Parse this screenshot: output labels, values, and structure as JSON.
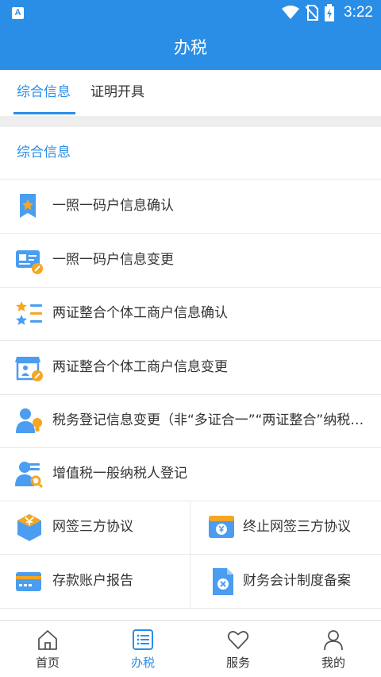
{
  "status_bar": {
    "time": "3:22",
    "app_badge": "A"
  },
  "header": {
    "title": "办税"
  },
  "tabs": [
    {
      "label": "综合信息",
      "active": true
    },
    {
      "label": "证明开具",
      "active": false
    }
  ],
  "section": {
    "title": "综合信息"
  },
  "list_items": [
    {
      "label": "一照一码户信息确认",
      "icon": "star-ribbon-icon"
    },
    {
      "label": "一照一码户信息变更",
      "icon": "id-card-edit-icon"
    },
    {
      "label": "两证整合个体工商户信息确认",
      "icon": "star-list-icon"
    },
    {
      "label": "两证整合个体工商户信息变更",
      "icon": "shop-edit-icon"
    },
    {
      "label": "税务登记信息变更（非“多证合一”“两证整合”纳税人）",
      "icon": "person-bulb-icon"
    },
    {
      "label": "增值税一般纳税人登记",
      "icon": "person-search-icon"
    }
  ],
  "grid_items": [
    {
      "label": "网签三方协议",
      "icon": "yuan-cube-icon"
    },
    {
      "label": "终止网签三方协议",
      "icon": "yuan-window-icon"
    },
    {
      "label": "存款账户报告",
      "icon": "bank-card-icon"
    },
    {
      "label": "财务会计制度备案",
      "icon": "document-close-icon"
    }
  ],
  "bottom_nav": [
    {
      "label": "首页",
      "icon": "home-icon",
      "active": false
    },
    {
      "label": "办税",
      "icon": "list-icon",
      "active": true
    },
    {
      "label": "服务",
      "icon": "heart-icon",
      "active": false
    },
    {
      "label": "我的",
      "icon": "user-icon",
      "active": false
    }
  ],
  "colors": {
    "primary": "#2b8ee6",
    "accent_orange": "#f5a623",
    "text": "#333333"
  }
}
